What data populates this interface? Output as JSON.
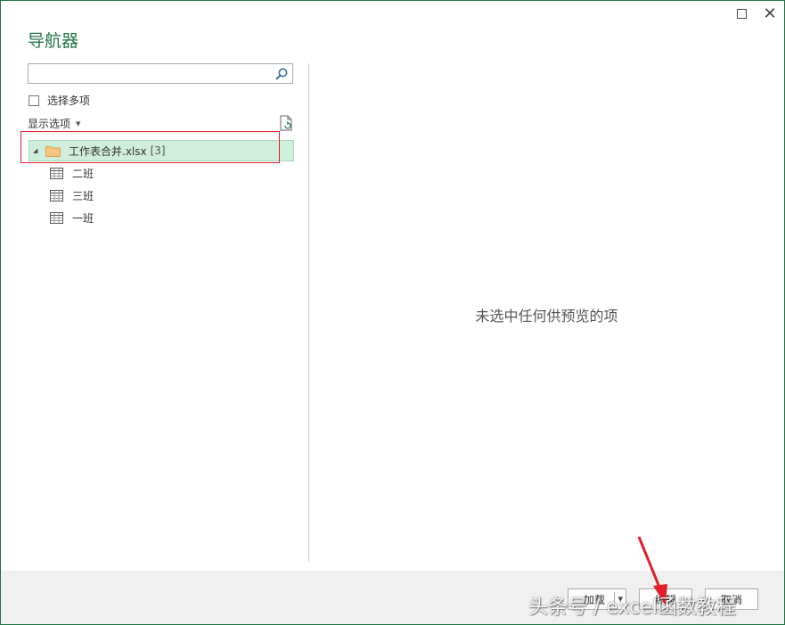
{
  "window": {
    "title": "导航器",
    "accent_color": "#217346",
    "controls": {
      "maximize_icon": "maximize-icon",
      "close_glyph": "✕"
    }
  },
  "left_panel": {
    "search": {
      "value": "",
      "placeholder": ""
    },
    "multi_select_label": "选择多项",
    "multi_select_checked": false,
    "display_options_label": "显示选项",
    "tree": {
      "root": {
        "label": "工作表合并.xlsx",
        "count": "[3]",
        "expanded": true,
        "selected": true
      },
      "children": [
        {
          "label": "二班"
        },
        {
          "label": "三班"
        },
        {
          "label": "一班"
        }
      ]
    }
  },
  "preview": {
    "message": "未选中任何供预览的项"
  },
  "footer": {
    "load_label": "加载",
    "edit_label": "编辑",
    "cancel_label": "取消"
  },
  "annotations": {
    "highlight_color": "#e0202a",
    "watermark": "头条号 / excel函数教程"
  }
}
